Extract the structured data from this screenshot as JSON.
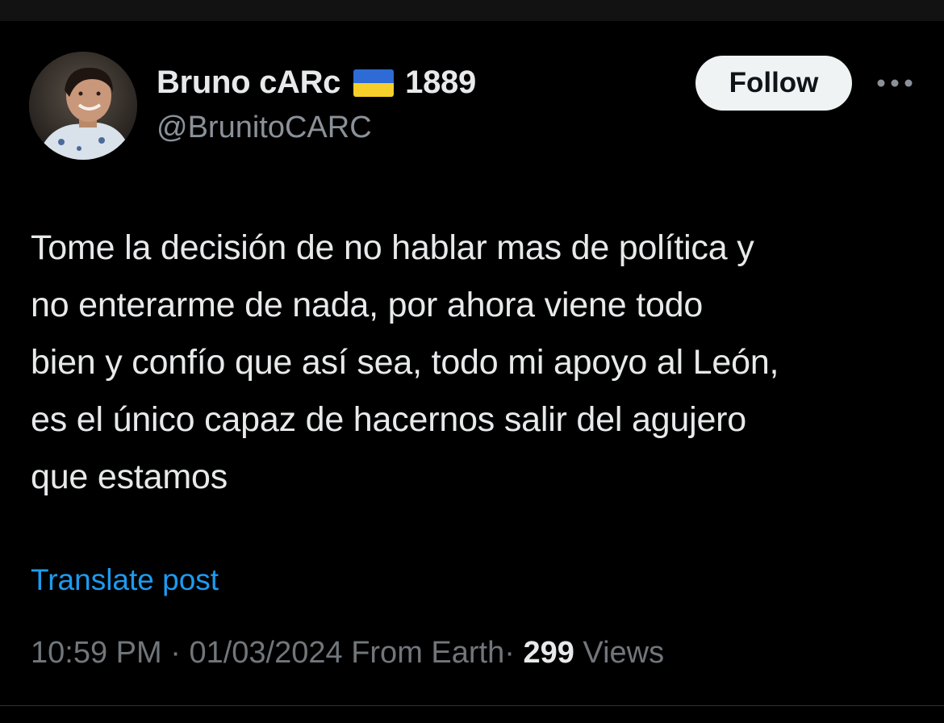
{
  "author": {
    "display_name": "Bruno cARc",
    "flag_icon": "ukraine-flag-icon",
    "name_suffix": "1889",
    "handle": "@BrunitoCARC",
    "avatar_icon": "profile-photo"
  },
  "actions": {
    "follow_label": "Follow",
    "more_icon": "more-dots-icon"
  },
  "post": {
    "text": "Tome la decisión de no hablar mas de política y\nno enterarme de nada, por ahora viene todo\nbien y confío que así sea, todo mi apoyo al León,\nes el único capaz de hacernos salir del agujero\nque estamos",
    "translate_label": "Translate post"
  },
  "meta": {
    "time": "10:59 PM",
    "separator": "·",
    "date": "01/03/2024",
    "source": "From Earth",
    "views_count": "299",
    "views_label": "Views"
  },
  "colors": {
    "background": "#000000",
    "text_primary": "#e7e9ea",
    "text_secondary": "#71767b",
    "link": "#1d9bf0",
    "follow_bg": "#eff3f4"
  }
}
